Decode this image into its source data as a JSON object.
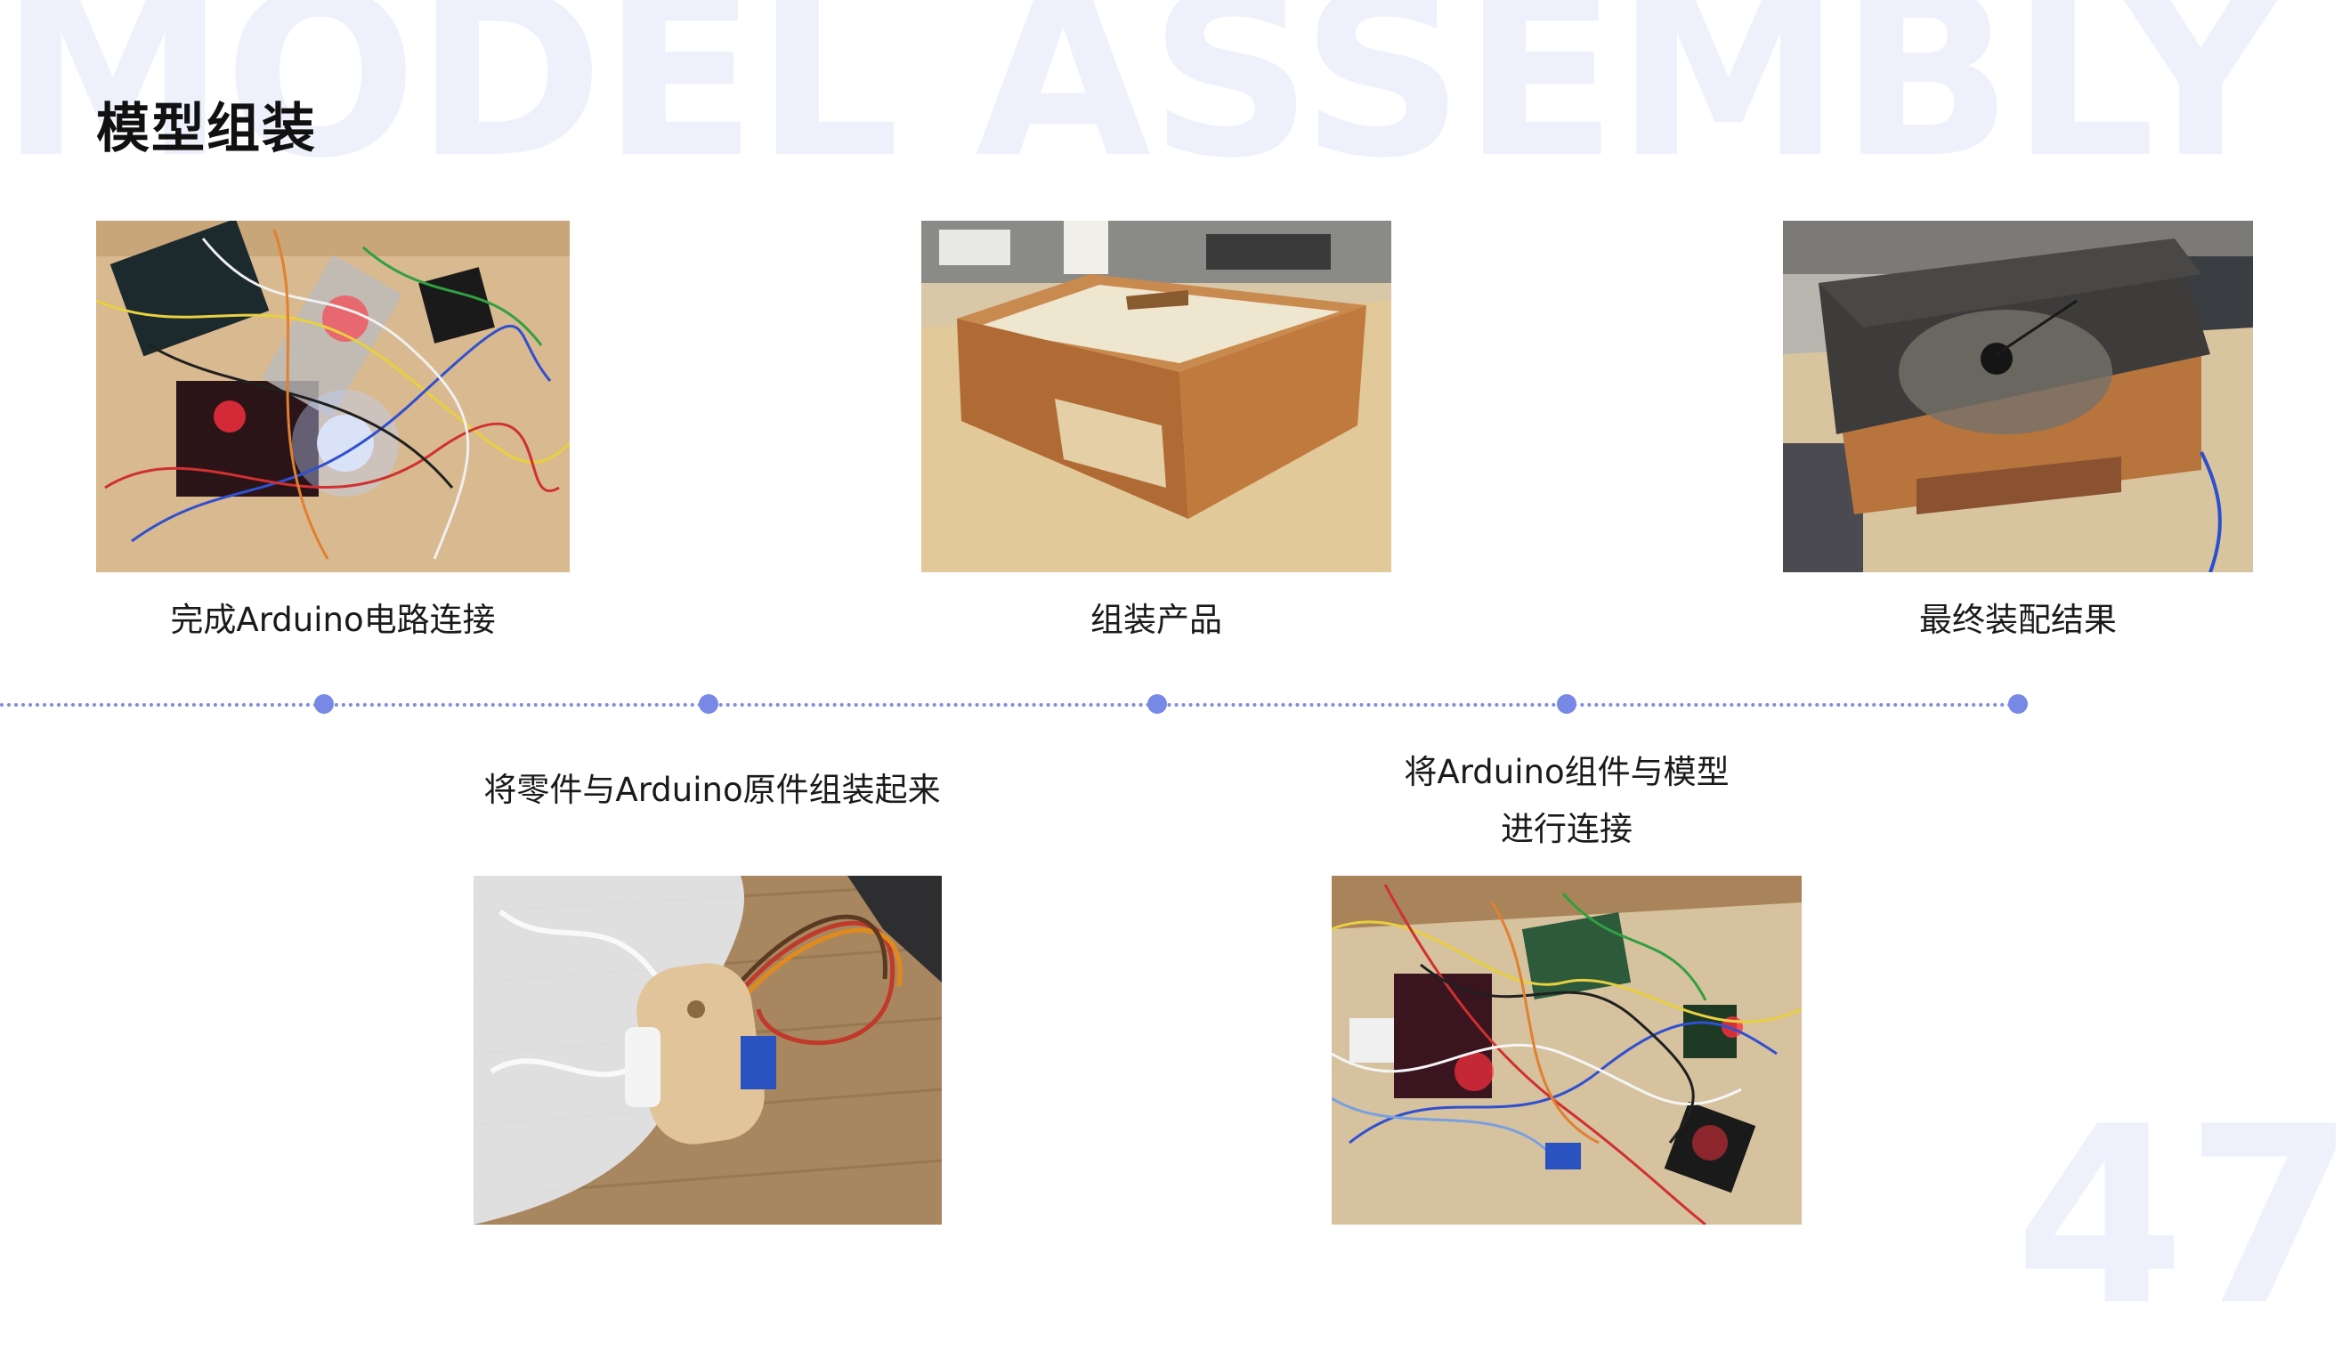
{
  "slide": {
    "background_text": "MODEL ASSEMBLY",
    "title": "模型组装",
    "page_number": "47"
  },
  "steps_top": [
    {
      "caption": "完成Arduino电路连接"
    },
    {
      "caption": "组装产品"
    },
    {
      "caption": "最终装配结果"
    }
  ],
  "steps_bottom": [
    {
      "caption_line1": "将零件与Arduino原件组装起来",
      "caption_line2": ""
    },
    {
      "caption_line1": "将Arduino组件与模型",
      "caption_line2": "进行连接"
    }
  ],
  "colors": {
    "accent": "#7888e6",
    "watermark": "#eef0fc"
  }
}
